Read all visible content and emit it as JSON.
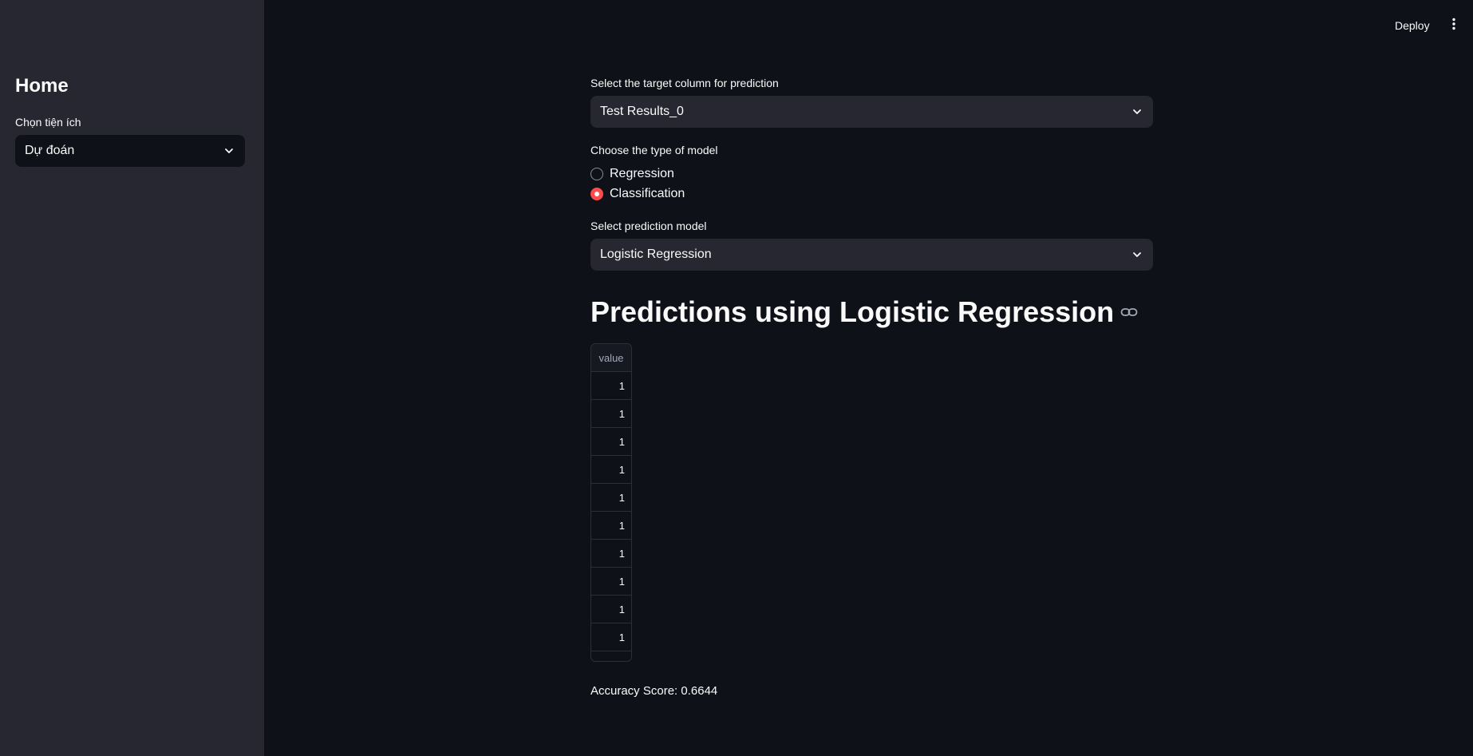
{
  "sidebar": {
    "title": "Home",
    "select_label": "Chọn tiện ích",
    "select_value": "Dự đoán"
  },
  "header": {
    "deploy_label": "Deploy",
    "menu_icon": "vertical-ellipsis-icon"
  },
  "main": {
    "target_label": "Select the target column for prediction",
    "target_value": "Test Results_0",
    "model_type_label": "Choose the type of model",
    "model_type_options": [
      {
        "label": "Regression",
        "selected": false
      },
      {
        "label": "Classification",
        "selected": true
      }
    ],
    "model_label": "Select prediction model",
    "model_value": "Logistic Regression",
    "heading": "Predictions using Logistic Regression",
    "table": {
      "column": "value",
      "rows": [
        "1",
        "1",
        "1",
        "1",
        "1",
        "1",
        "1",
        "1",
        "1",
        "1"
      ]
    },
    "accuracy_text": "Accuracy Score: 0.6644"
  },
  "colors": {
    "background": "#0e1117",
    "sidebar": "#262730",
    "accent": "#ff4b4b",
    "text": "#fafafa"
  }
}
